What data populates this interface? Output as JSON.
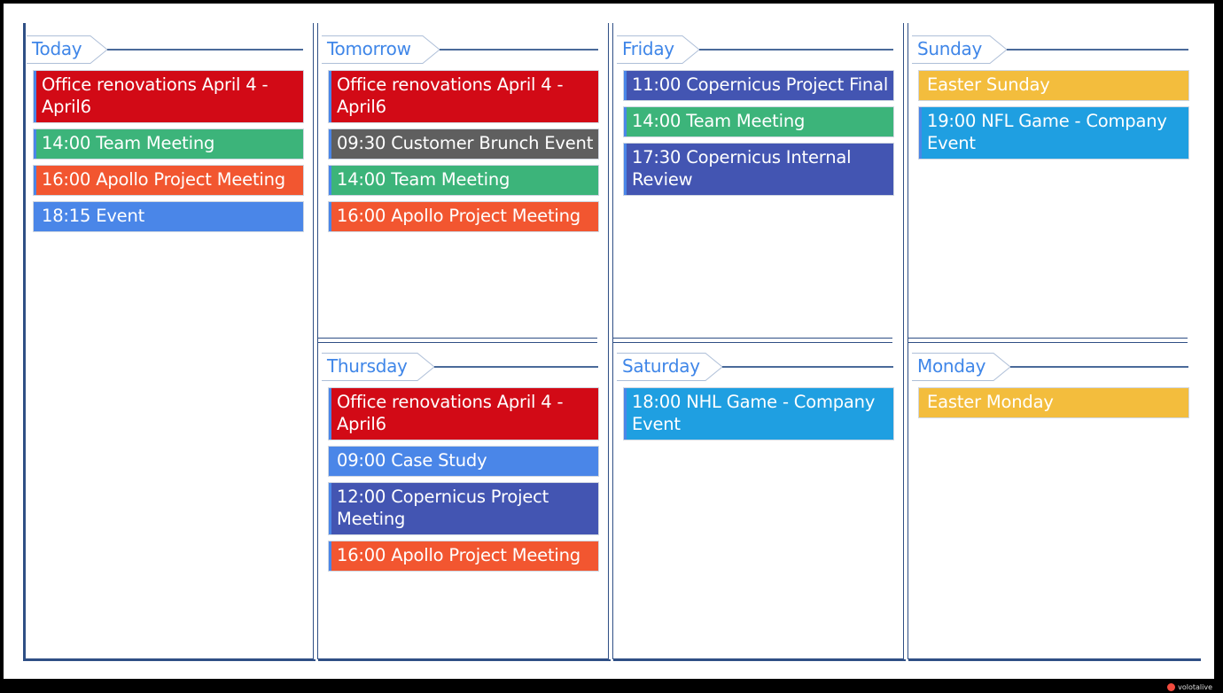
{
  "colors": {
    "header_text": "#3f86e8",
    "frame": "#2f4f85",
    "red": "#d20a16",
    "green": "#3cb47a",
    "orange": "#f25630",
    "blue": "#4a86e8",
    "gray": "#5f5f5f",
    "indigo": "#4355b2",
    "sky": "#1f9fe1",
    "yellow": "#f3bd3d"
  },
  "days": [
    {
      "id": "today",
      "label": "Today",
      "events": [
        {
          "text": "Office renovations April 4 - April6",
          "color": "red"
        },
        {
          "text": "14:00 Team Meeting",
          "color": "green"
        },
        {
          "text": "16:00 Apollo Project Meeting",
          "color": "orange"
        },
        {
          "text": "18:15 Event",
          "color": "blue"
        }
      ]
    },
    {
      "id": "tomorrow",
      "label": "Tomorrow",
      "events": [
        {
          "text": "Office renovations April 4 - April6",
          "color": "red"
        },
        {
          "text": "09:30 Customer Brunch Event",
          "color": "gray"
        },
        {
          "text": "14:00 Team Meeting",
          "color": "green"
        },
        {
          "text": "16:00 Apollo Project Meeting",
          "color": "orange"
        }
      ]
    },
    {
      "id": "friday",
      "label": "Friday",
      "events": [
        {
          "text": "11:00 Copernicus Project Final",
          "color": "indigo"
        },
        {
          "text": "14:00 Team Meeting",
          "color": "green"
        },
        {
          "text": "17:30 Copernicus Internal Review",
          "color": "indigo"
        }
      ]
    },
    {
      "id": "sunday",
      "label": "Sunday",
      "events": [
        {
          "text": "Easter Sunday",
          "color": "yellow",
          "allday": true
        },
        {
          "text": "19:00 NFL Game - Company Event",
          "color": "sky"
        }
      ]
    },
    {
      "id": "thursday",
      "label": "Thursday",
      "events": [
        {
          "text": "Office renovations April 4 - April6",
          "color": "red"
        },
        {
          "text": "09:00 Case Study",
          "color": "blue"
        },
        {
          "text": "12:00 Copernicus Project Meeting",
          "color": "indigo"
        },
        {
          "text": "16:00 Apollo Project Meeting",
          "color": "orange"
        }
      ]
    },
    {
      "id": "saturday",
      "label": "Saturday",
      "events": [
        {
          "text": "18:00 NHL Game - Company Event",
          "color": "sky"
        }
      ]
    },
    {
      "id": "monday",
      "label": "Monday",
      "events": [
        {
          "text": "Easter Monday",
          "color": "yellow",
          "allday": true
        }
      ]
    }
  ],
  "branding": {
    "text": "volotalive",
    "icon": "red-dot-logo-icon"
  }
}
